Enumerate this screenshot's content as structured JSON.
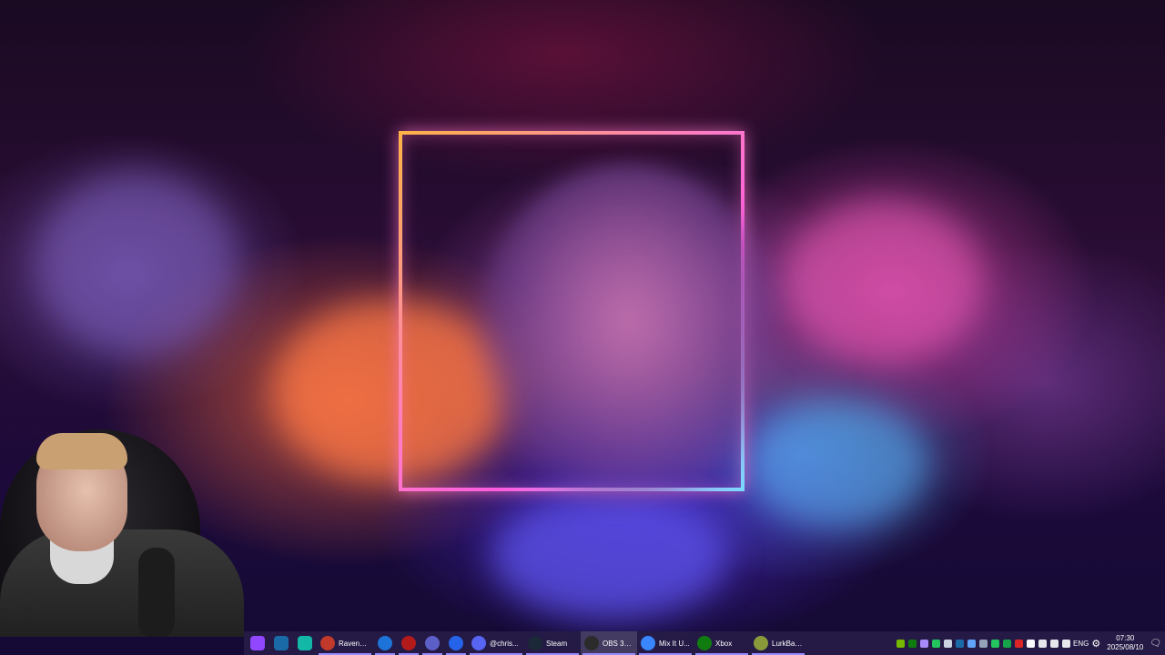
{
  "taskbar": {
    "pinned": [
      {
        "name": "twitch-icon",
        "color": "#9146ff"
      },
      {
        "name": "steam-icon",
        "color": "#1b6aa8"
      },
      {
        "name": "app-p-icon",
        "color": "#14b8a6"
      }
    ],
    "apps": [
      {
        "label": "RavenRi...",
        "icon": "ravenri-icon",
        "color": "#c0392b"
      },
      {
        "label": "",
        "icon": "edge-browser-icon",
        "color": "#1e73d8"
      },
      {
        "label": "",
        "icon": "red-app-icon",
        "color": "#b31b1b"
      },
      {
        "label": "",
        "icon": "teams-icon",
        "color": "#5b5fc7"
      },
      {
        "label": "",
        "icon": "app-circle-icon",
        "color": "#2563eb"
      },
      {
        "label": "@chris...",
        "icon": "discord-icon",
        "color": "#5865f2"
      },
      {
        "label": "Steam",
        "icon": "steam-icon",
        "color": "#1b2838"
      },
      {
        "label": "OBS 31....",
        "icon": "obs-icon",
        "color": "#2b2b2b"
      },
      {
        "label": "Mix It U...",
        "icon": "mixitup-icon",
        "color": "#3a86ff"
      },
      {
        "label": "Xbox",
        "icon": "xbox-icon",
        "color": "#107c10"
      },
      {
        "label": "LurkBait...",
        "icon": "lurkbait-icon",
        "color": "#8a9a3a"
      }
    ],
    "tray": {
      "icons": [
        {
          "name": "nvidia-icon",
          "color": "#76b900"
        },
        {
          "name": "xbox-tray-icon",
          "color": "#107c10"
        },
        {
          "name": "purple-tray-icon",
          "color": "#a78bfa"
        },
        {
          "name": "green-dot-icon",
          "color": "#22c55e"
        },
        {
          "name": "globe-icon",
          "color": "#cbd5e1"
        },
        {
          "name": "steam-tray-icon",
          "color": "#1b6aa8"
        },
        {
          "name": "cloud-tray-icon",
          "color": "#60a5fa"
        },
        {
          "name": "link-tray-icon",
          "color": "#94a3b8"
        },
        {
          "name": "play-tray-icon",
          "color": "#22c55e"
        },
        {
          "name": "battery-tray-icon",
          "color": "#16a34a"
        },
        {
          "name": "red-b-tray-icon",
          "color": "#dc2626"
        },
        {
          "name": "shield-tray-icon",
          "color": "#f8fafc"
        },
        {
          "name": "microphone-icon",
          "color": "#e5e7eb"
        },
        {
          "name": "network-icon",
          "color": "#e5e7eb"
        },
        {
          "name": "volume-icon",
          "color": "#e5e7eb"
        }
      ],
      "language": "ENG",
      "settings_icon": "gear-icon"
    },
    "clock": {
      "time": "07:30",
      "date": "2025/08/10"
    },
    "notifications_icon": "notification-icon"
  }
}
